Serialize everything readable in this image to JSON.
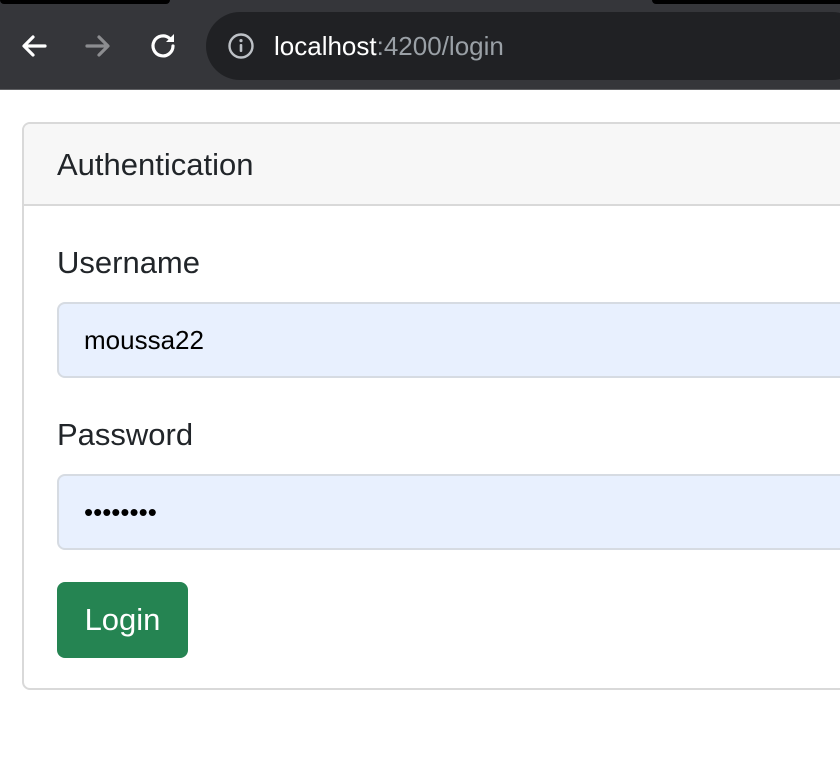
{
  "browser": {
    "url_host": "localhost",
    "url_rest": ":4200/login",
    "icons": {
      "back": "back-arrow-icon",
      "forward": "forward-arrow-icon",
      "reload": "reload-icon",
      "site_info": "info-icon"
    }
  },
  "card": {
    "title": "Authentication"
  },
  "form": {
    "username_label": "Username",
    "username_value": "moussa22",
    "password_label": "Password",
    "password_value": "••••••••",
    "login_label": "Login"
  },
  "colors": {
    "browser_bar": "#35363a",
    "omnibox": "#202124",
    "card_header": "#f7f7f7",
    "input_background": "#e8f0fe",
    "login_button": "#258452"
  }
}
